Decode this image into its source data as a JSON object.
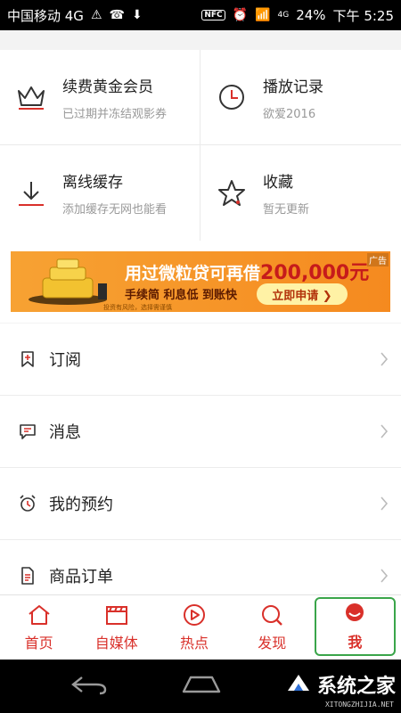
{
  "status_bar": {
    "carrier": "中国移动 4G",
    "nfc": "NFC",
    "signal_label": "4G",
    "battery": "24%",
    "time": "下午 5:25"
  },
  "grid": [
    {
      "title": "续费黄金会员",
      "subtitle": "已过期并冻结观影券",
      "icon": "crown-icon"
    },
    {
      "title": "播放记录",
      "subtitle": "欲爱2016",
      "icon": "clock-icon"
    },
    {
      "title": "离线缓存",
      "subtitle": "添加缓存无网也能看",
      "icon": "download-icon"
    },
    {
      "title": "收藏",
      "subtitle": "暂无更新",
      "icon": "star-icon"
    }
  ],
  "banner": {
    "headline": "用过微粒贷可再借",
    "amount": "200,000元",
    "features": "手续简 利息低 到账快",
    "cta": "立即申请 ❯",
    "tag": "广告",
    "fine_print": "投资有风险，选择需谨慎"
  },
  "list": [
    {
      "label": "订阅",
      "icon": "bookmark-plus-icon"
    },
    {
      "label": "消息",
      "icon": "message-icon"
    },
    {
      "label": "我的预约",
      "icon": "alarm-icon"
    },
    {
      "label": "商品订单",
      "icon": "order-document-icon"
    }
  ],
  "tabbar": [
    {
      "label": "首页",
      "icon": "home-icon"
    },
    {
      "label": "自媒体",
      "icon": "clapperboard-icon"
    },
    {
      "label": "热点",
      "icon": "play-circle-icon"
    },
    {
      "label": "发现",
      "icon": "discover-search-icon"
    },
    {
      "label": "我",
      "icon": "profile-icon",
      "active": true
    }
  ],
  "watermark": {
    "text": "系统之家",
    "url": "XITONGZHIJIA.NET"
  },
  "colors": {
    "accent": "#d9302a",
    "active_outline": "#3aa54a",
    "banner_orange": "#f58a1f"
  }
}
